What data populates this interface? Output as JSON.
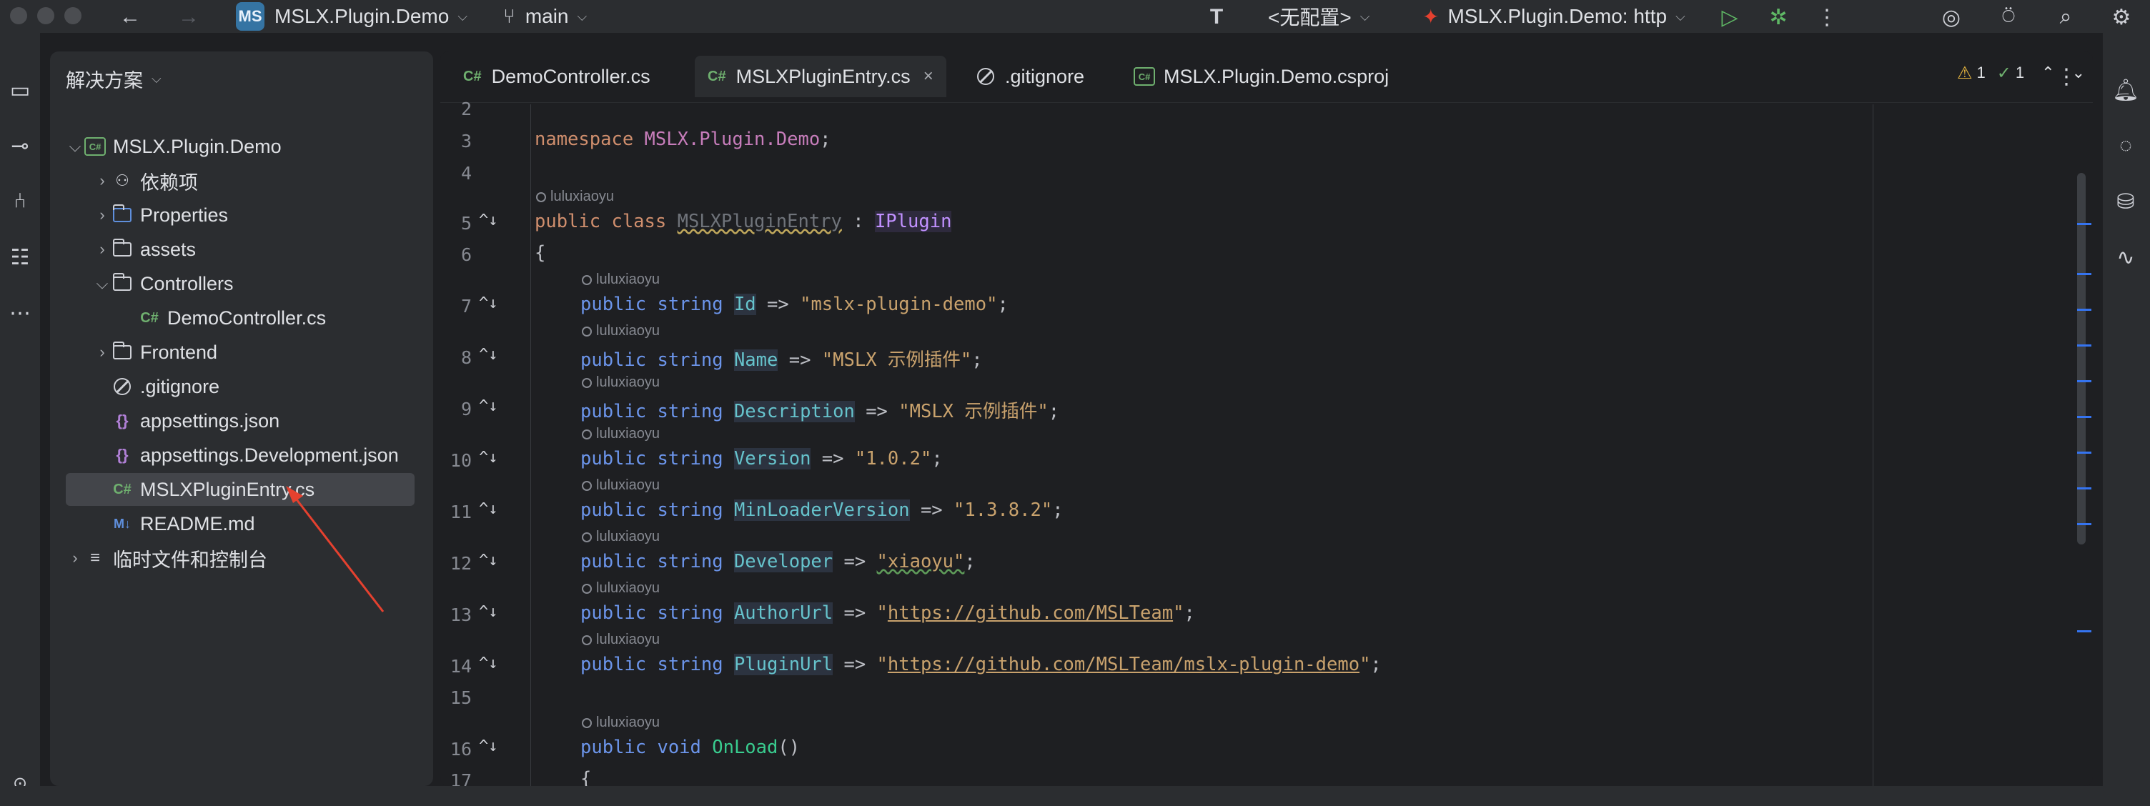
{
  "window": {
    "project_badge": "MS",
    "project_name": "MSLX.Plugin.Demo",
    "branch": "main",
    "config": "<无配置>",
    "run_config": "MSLX.Plugin.Demo: http"
  },
  "project_panel": {
    "header": "解决方案",
    "tree": [
      {
        "label": "MSLX.Plugin.Demo",
        "icon": "csharp-project-icon",
        "expanded": true
      },
      {
        "label": "依赖项",
        "icon": "dependencies-icon",
        "expanded": false
      },
      {
        "label": "Properties",
        "icon": "properties-folder-icon",
        "expanded": false
      },
      {
        "label": "assets",
        "icon": "folder-icon",
        "expanded": false
      },
      {
        "label": "Controllers",
        "icon": "folder-icon",
        "expanded": true
      },
      {
        "label": "DemoController.cs",
        "icon": "csharp-file-icon"
      },
      {
        "label": "Frontend",
        "icon": "folder-icon",
        "expanded": false
      },
      {
        "label": ".gitignore",
        "icon": "gitignore-icon"
      },
      {
        "label": "appsettings.json",
        "icon": "json-file-icon"
      },
      {
        "label": "appsettings.Development.json",
        "icon": "json-file-icon"
      },
      {
        "label": "MSLXPluginEntry.cs",
        "icon": "csharp-file-icon",
        "selected": true
      },
      {
        "label": "README.md",
        "icon": "markdown-file-icon"
      },
      {
        "label": "临时文件和控制台",
        "icon": "scratches-icon",
        "expanded": false
      }
    ]
  },
  "tabs": [
    {
      "label": "DemoController.cs",
      "active": false
    },
    {
      "label": "MSLXPluginEntry.cs",
      "active": true
    },
    {
      "label": ".gitignore",
      "active": false
    },
    {
      "label": "MSLX.Plugin.Demo.csproj",
      "active": false
    }
  ],
  "inspections": {
    "warnings": "1",
    "ok": "1"
  },
  "editor": {
    "author": "luluxiaoyu",
    "lines": [
      {
        "n": "2"
      },
      {
        "n": "3"
      },
      {
        "n": "4"
      },
      {
        "n": "5"
      },
      {
        "n": "6"
      },
      {
        "n": "7"
      },
      {
        "n": "8"
      },
      {
        "n": "9"
      },
      {
        "n": "10"
      },
      {
        "n": "11"
      },
      {
        "n": "12"
      },
      {
        "n": "13"
      },
      {
        "n": "14"
      },
      {
        "n": "15"
      },
      {
        "n": "16"
      },
      {
        "n": "17"
      }
    ],
    "code": {
      "ns_kw": "namespace",
      "ns_name": "MSLX.Plugin.Demo",
      "class_decl": "public class",
      "class_name": "MSLXPluginEntry",
      "colon": " : ",
      "iface": "IPlugin",
      "open_brace": "{",
      "ps": "public string",
      "arrow": " => ",
      "props": [
        {
          "name": "Id",
          "value": "\"mslx-plugin-demo\""
        },
        {
          "name": "Name",
          "value": "\"MSLX 示例插件\""
        },
        {
          "name": "Description",
          "value": "\"MSLX 示例插件\""
        },
        {
          "name": "Version",
          "value": "\"1.0.2\""
        },
        {
          "name": "MinLoaderVersion",
          "value": "\"1.3.8.2\""
        },
        {
          "name": "Developer",
          "value": "\"xiaoyu\""
        },
        {
          "name": "AuthorUrl",
          "value": "https://github.com/MSLTeam"
        },
        {
          "name": "PluginUrl",
          "value": "https://github.com/MSLTeam/mslx-plugin-demo"
        }
      ],
      "void_decl": "public void",
      "method_name": "OnLoad",
      "parens": "()"
    }
  },
  "colors": {
    "accent": "#3574f0",
    "annotation": "#e5412f"
  }
}
